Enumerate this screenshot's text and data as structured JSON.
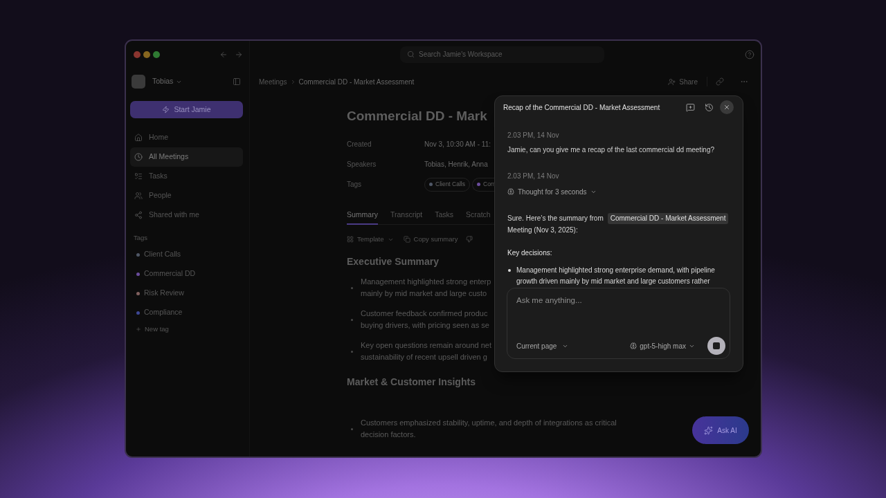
{
  "sidebar": {
    "user": {
      "name": "Tobias"
    },
    "start_button": "Start Jamie",
    "nav": [
      {
        "label": "Home",
        "selected": false
      },
      {
        "label": "All Meetings",
        "selected": true
      },
      {
        "label": "Tasks",
        "selected": false
      },
      {
        "label": "People",
        "selected": false
      },
      {
        "label": "Shared with me",
        "selected": false
      }
    ],
    "tags_heading": "Tags",
    "tags": [
      {
        "label": "Client Calls",
        "color": "#4f5766"
      },
      {
        "label": "Commercial DD",
        "color": "#6a4c9c"
      },
      {
        "label": "Risk Review",
        "color": "#80605e"
      },
      {
        "label": "Compliance",
        "color": "#3d4794"
      }
    ],
    "new_tag": "New tag"
  },
  "top_bar": {
    "search": {
      "placeholder": "Search Jamie's Workspace"
    }
  },
  "breadcrumbs": [
    "Meetings",
    "Commercial DD - Market Assessment"
  ],
  "page_actions": {
    "share": "Share"
  },
  "meeting": {
    "title": "Commercial DD - Mark",
    "properties": [
      {
        "kind": "text",
        "label": "Created",
        "value": "Nov 3, 10:30 AM - 11:"
      },
      {
        "kind": "text",
        "label": "Speakers",
        "value": "Tobias, Henrik, Anna"
      },
      {
        "kind": "tags",
        "label": "Tags",
        "tags": [
          {
            "label": "Client Calls",
            "color": "#4f5766"
          },
          {
            "label": "Com",
            "color": "#6a4c9c"
          }
        ]
      }
    ],
    "tabs": [
      {
        "label": "Summary",
        "selected": true
      },
      {
        "label": "Transcript",
        "selected": false
      },
      {
        "label": "Tasks",
        "selected": false
      },
      {
        "label": "Scratch",
        "selected": false
      }
    ],
    "toolbar": {
      "template": "Template",
      "copy": "Copy summary"
    },
    "sections": [
      {
        "heading": "Executive Summary",
        "bullets": [
          {
            "lines": [
              "Management highlighted strong enterp",
              "mainly by mid market and large custo"
            ]
          },
          {
            "lines": [
              "Customer feedback confirmed produc",
              "buying drivers, with pricing seen as se"
            ]
          },
          {
            "lines": [
              "Key open questions remain around net",
              "sustainability of recent upsell driven g"
            ]
          }
        ]
      },
      {
        "heading": "Market & Customer Insights",
        "bullets": [
          {
            "lines": [
              "Customers emphasized stability, uptime, and depth of integrations as critical",
              "decision factors."
            ]
          }
        ]
      }
    ]
  },
  "ask_ai": {
    "label": "Ask AI"
  },
  "chat": {
    "title": "Recap of the Commercial DD - Market Assessment",
    "messages": [
      {
        "kind": "user",
        "time": "2.03 PM, 14 Nov",
        "text": "Jamie, can you give me a recap of the last commercial dd meeting?"
      },
      {
        "kind": "assistant",
        "time": "2.03 PM, 14 Nov",
        "thought": "Thought for 3 seconds",
        "intro": "Sure. Here’s the summary from",
        "reference": "Commercial DD - Market Assessment",
        "intro_end": "Meeting (Nov 3, 2025):",
        "heading": "Key decisions:",
        "bullets": [
          {
            "lines": [
              "Management highlighted strong enterprise demand, with pipeline",
              "growth driven mainly by mid market and large customers rather"
            ]
          }
        ]
      }
    ],
    "composer": {
      "placeholder": "Ask me anything...",
      "context": "Current page",
      "model": "gpt-5-high max"
    }
  }
}
